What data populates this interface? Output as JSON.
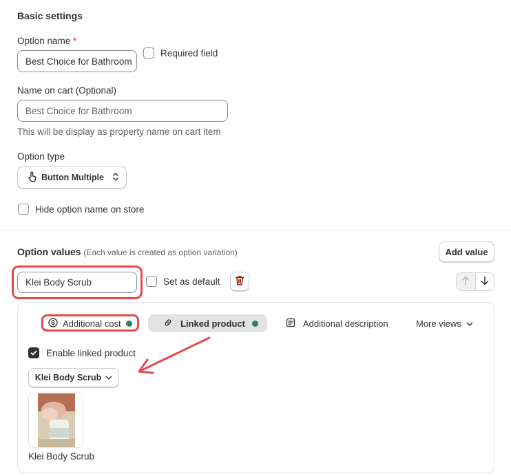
{
  "basic": {
    "title": "Basic settings",
    "option_name_label": "Option name",
    "required_mark": "*",
    "option_name_value": "Best Choice for Bathroom",
    "required_field_label": "Required field",
    "name_on_cart_label": "Name on cart (Optional)",
    "name_on_cart_placeholder": "Best Choice for Bathroom",
    "name_on_cart_help": "This will be display as property name on cart item",
    "option_type_label": "Option type",
    "option_type_value": "Button Multiple",
    "hide_option_label": "Hide option name on store"
  },
  "option_values": {
    "title": "Option values",
    "subtitle": "(Each value is created as option variation)",
    "add_value_label": "Add value",
    "value_input": "Klei Body Scrub",
    "set_default_label": "Set as default"
  },
  "tabs": [
    {
      "label": "Additional cost",
      "icon": "dollar-circle-icon",
      "status_color": "#29845a"
    },
    {
      "label": "Linked product",
      "icon": "link-icon",
      "status_color": "#29845a"
    },
    {
      "label": "Additional description",
      "icon": "text-block-icon"
    },
    {
      "label": "More views",
      "icon": "chevron-down-icon"
    }
  ],
  "linked": {
    "enable_label": "Enable linked product",
    "enabled": true,
    "selected_product": "Klei Body Scrub",
    "product_caption": "Klei Body Scrub"
  },
  "colors": {
    "accent_red": "#e5484d",
    "status_green": "#29845a",
    "delete_red": "#8e1f0b"
  }
}
